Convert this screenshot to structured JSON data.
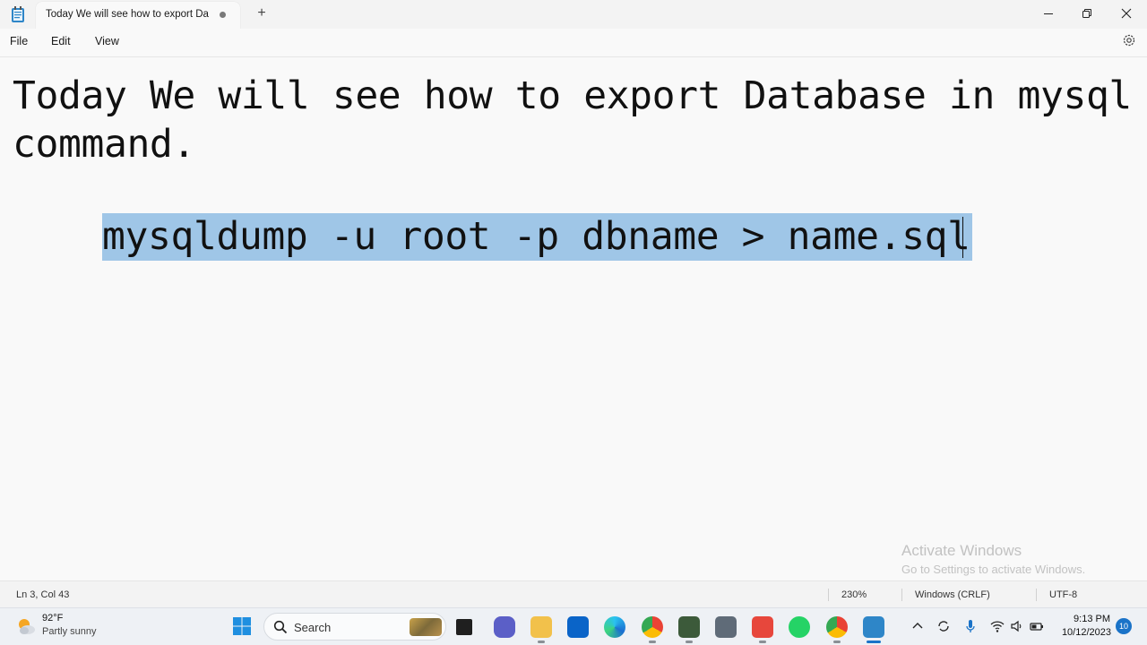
{
  "window": {
    "tab_title": "Today We will see how to export Da",
    "new_tab_label": "+",
    "controls": [
      "minimize-icon",
      "restore-icon",
      "close-icon"
    ]
  },
  "menu": {
    "items": [
      "File",
      "Edit",
      "View"
    ],
    "settings_icon": "gear-icon"
  },
  "document": {
    "line1": "Today We will see how to export Database in mysql command.",
    "line3": "mysqldump -u root -p dbname > name.sql",
    "selection_color": "#9fc6e7"
  },
  "watermark": {
    "title": "Activate Windows",
    "subtitle": "Go to Settings to activate Windows."
  },
  "statusbar": {
    "position": "Ln 3, Col 43",
    "zoom": "230%",
    "line_ending": "Windows (CRLF)",
    "encoding": "UTF-8"
  },
  "taskbar": {
    "weather": {
      "temp": "92°F",
      "desc": "Partly sunny",
      "icon": "partly-sunny-icon"
    },
    "search_label": "Search",
    "apps": [
      "file-explorer-icon",
      "teams-icon",
      "folder-icon",
      "outlook-icon",
      "edge-icon",
      "chrome-icon",
      "app-icon",
      "snip-icon",
      "camera-icon",
      "whatsapp-icon",
      "chrome-dev-icon",
      "notepad-icon"
    ],
    "clock": {
      "time": "9:13 PM",
      "date": "10/12/2023"
    },
    "notifications": "10"
  }
}
